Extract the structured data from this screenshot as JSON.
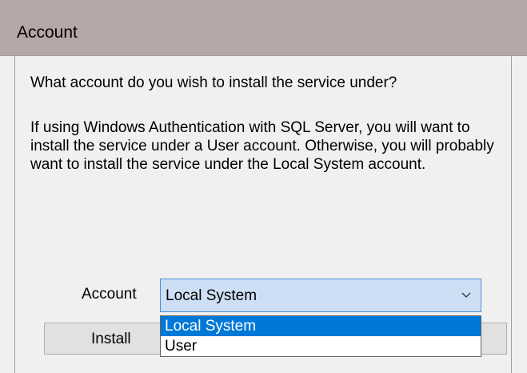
{
  "window": {
    "title": "Account"
  },
  "body": {
    "question": "What account do you wish to install the service under?",
    "description": "If using Windows Authentication with SQL Server, you will want to install the service under a User account.  Otherwise, you will probably want to install the service under the Local System account."
  },
  "account": {
    "label": "Account",
    "selected": "Local System",
    "options": [
      "Local System",
      "User"
    ]
  },
  "buttons": {
    "install": "Install"
  },
  "colors": {
    "title_bar": "#b5a7a5",
    "selection": "#0078d7",
    "combo_focus": "#ccdff5"
  }
}
